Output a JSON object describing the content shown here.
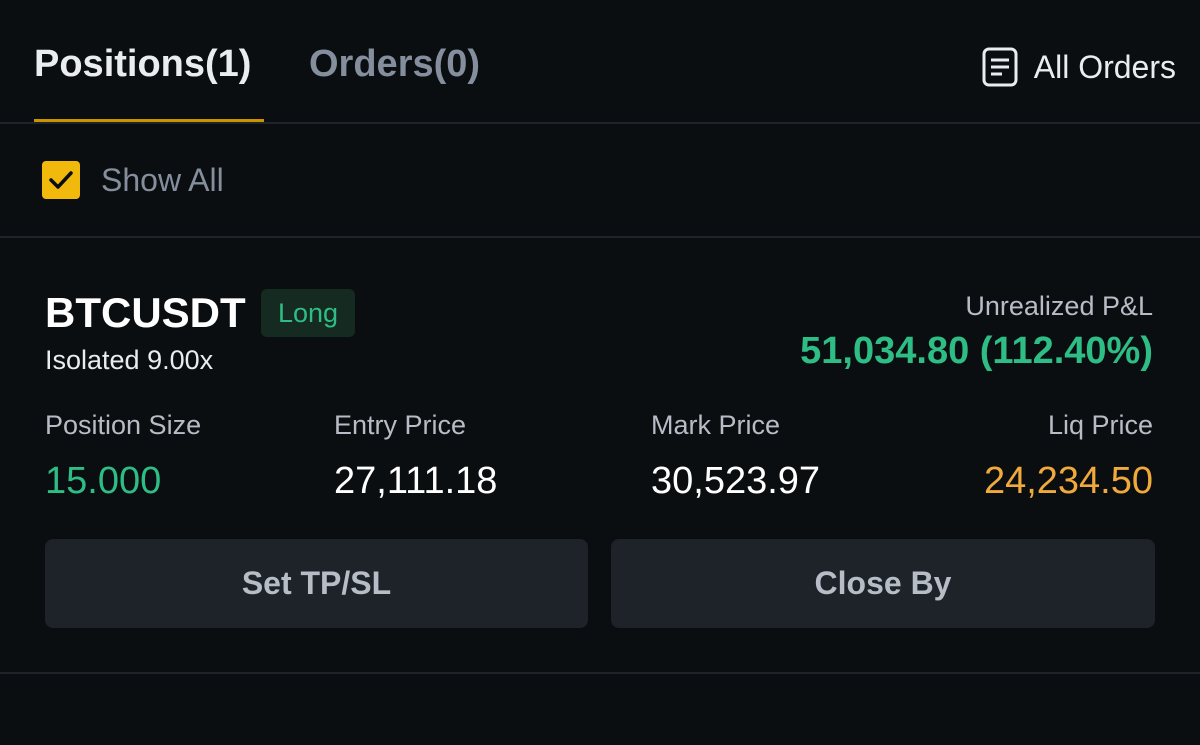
{
  "tabs": [
    {
      "label": "Positions(1)",
      "active": true
    },
    {
      "label": "Orders(0)",
      "active": false
    }
  ],
  "all_orders": {
    "label": "All Orders",
    "icon": "document-list-icon"
  },
  "filter": {
    "show_all_label": "Show All",
    "checked": true
  },
  "position": {
    "symbol": "BTCUSDT",
    "side": "Long",
    "margin_mode": "Isolated 9.00x",
    "pnl_label": "Unrealized P&L",
    "pnl_value": "51,034.80 (112.40%)",
    "stats": {
      "size_label": "Position Size",
      "size_value": "15.000",
      "entry_label": "Entry Price",
      "entry_value": "27,111.18",
      "mark_label": "Mark Price",
      "mark_value": "30,523.97",
      "liq_label": "Liq Price",
      "liq_value": "24,234.50"
    },
    "buttons": {
      "tpsl": "Set TP/SL",
      "close": "Close By"
    }
  },
  "colors": {
    "background": "#0b0e11",
    "accent": "#f0b90b",
    "tab_underline": "#c99400",
    "positive": "#2ebd85",
    "liquidation": "#f0a93b",
    "button_bg": "#1e2329",
    "primary_text": "#eaecef",
    "secondary_text": "#848e9c"
  }
}
